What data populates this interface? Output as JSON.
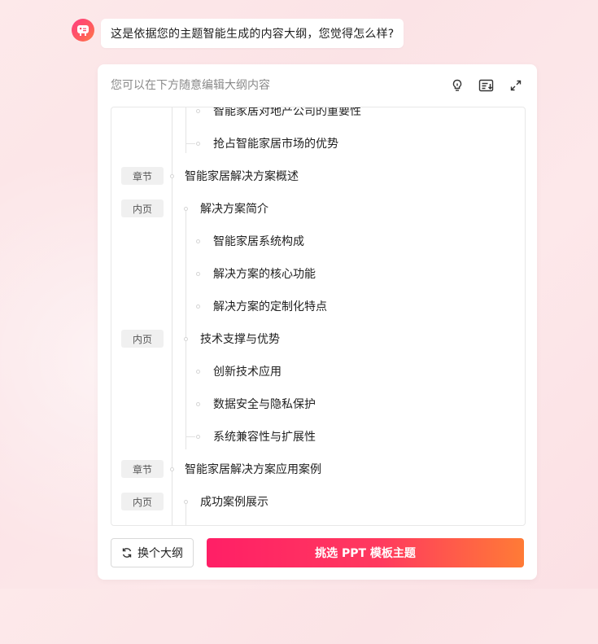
{
  "message": "这是依据您的主题智能生成的内容大纲，您觉得怎么样?",
  "card": {
    "hint": "您可以在下方随意编辑大纲内容"
  },
  "tags": {
    "chapter": "章节",
    "page": "内页"
  },
  "outline": {
    "items": [
      "智能家居对地产公司的重要性",
      "抢占智能家居市场的优势",
      "智能家居解决方案概述",
      "解决方案简介",
      "智能家居系统构成",
      "解决方案的核心功能",
      "解决方案的定制化特点",
      "技术支撑与优势",
      "创新技术应用",
      "数据安全与隐私保护",
      "系统兼容性与扩展性",
      "智能家居解决方案应用案例",
      "成功案例展示"
    ]
  },
  "buttons": {
    "change_outline": "换个大纲",
    "pick_template": "挑选 PPT 模板主题"
  },
  "colors": {
    "accent_start": "#ff1f66",
    "accent_end": "#ff7b36"
  }
}
